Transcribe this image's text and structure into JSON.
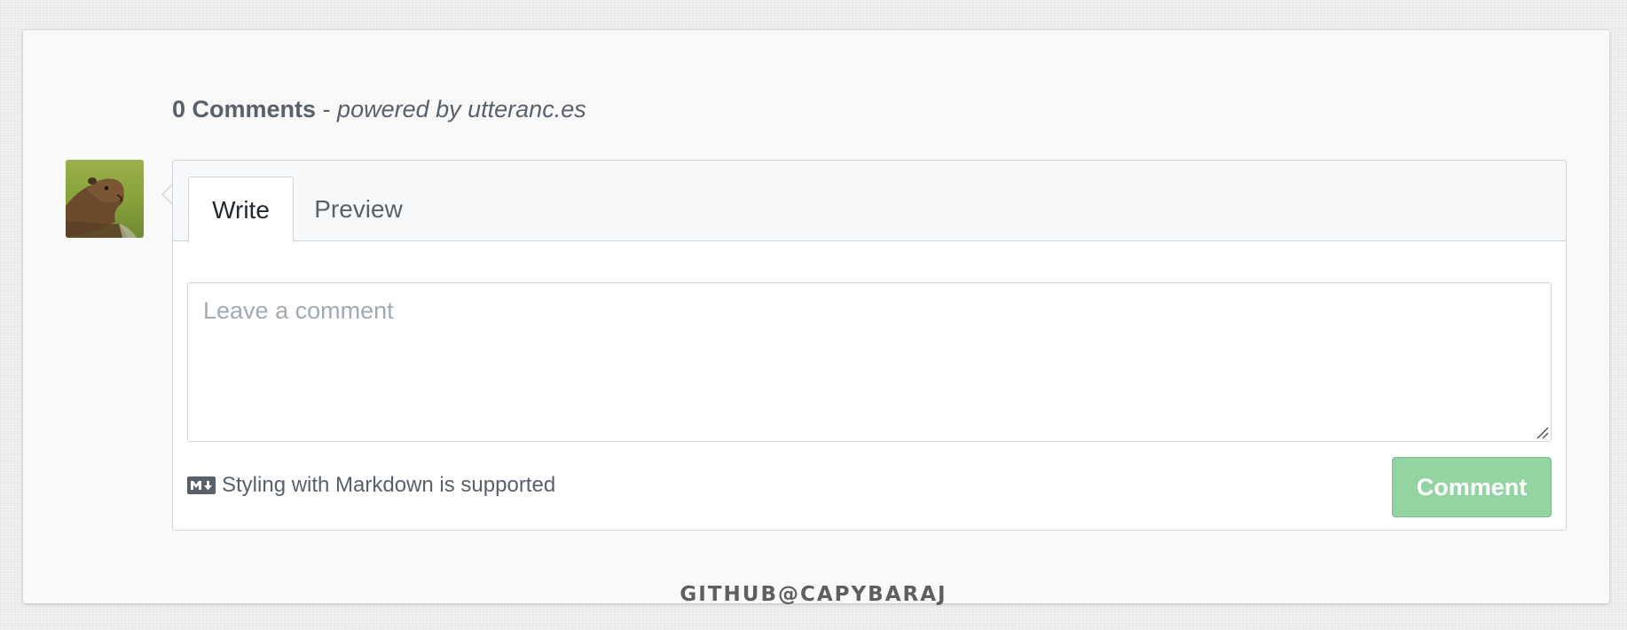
{
  "header": {
    "comment_count": "0 Comments",
    "separator": " - ",
    "powered_by": "powered by utteranc.es"
  },
  "avatar": {
    "icon": "capybara-avatar-photo"
  },
  "editor": {
    "tabs": [
      {
        "label": "Write",
        "selected": true
      },
      {
        "label": "Preview",
        "selected": false
      }
    ],
    "textarea": {
      "placeholder": "Leave a comment",
      "value": ""
    },
    "markdown_note": {
      "icon": "markdown-icon",
      "text": "Styling with Markdown is supported"
    },
    "submit_label": "Comment"
  },
  "footer": {
    "credit": "GITHUB@CAPYBARAJ"
  },
  "colors": {
    "page_background": "#ececec",
    "card_background": "#f9f9f9",
    "tab_bar_background": "#f6f8fa",
    "border": "#d1d5da",
    "text_primary": "#24292e",
    "text_secondary": "#586069",
    "placeholder": "#a3aab1",
    "button_disabled_green": "#94d3a2"
  }
}
